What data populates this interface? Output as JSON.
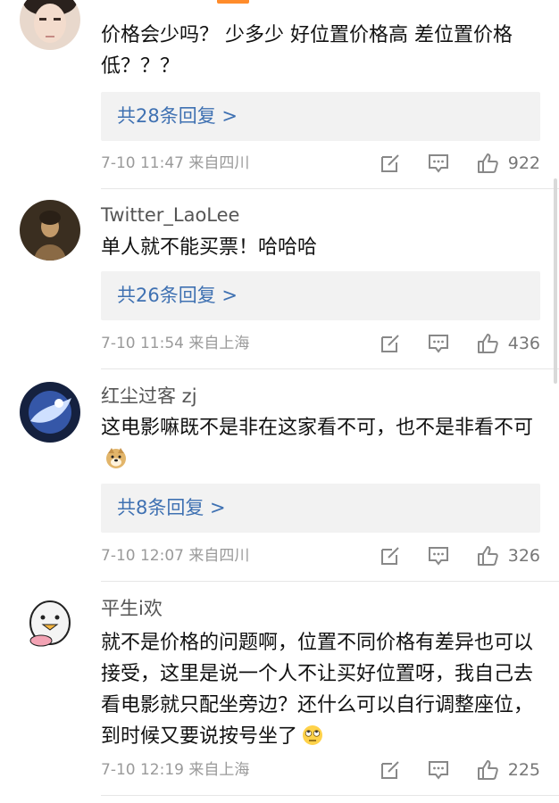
{
  "colors": {
    "link": "#3f71b2",
    "meta": "#9a9a9a",
    "reply_bg": "#f2f2f2"
  },
  "comments": [
    {
      "username": "",
      "text": "价格会少吗？ 少多少 好位置价格高 差位置价格低？？？",
      "replies_label": "共28条回复 >",
      "time": "7-10 11:47 来自四川",
      "likes": "922"
    },
    {
      "username": "Twitter_LaoLee",
      "text": "单人就不能买票！哈哈哈",
      "replies_label": "共26条回复 >",
      "time": "7-10 11:54 来自上海",
      "likes": "436"
    },
    {
      "username": "红尘过客 zj",
      "text": "这电影嘛既不是非在这家看不可，也不是非看不可",
      "emoji": "doge-emoji",
      "replies_label": "共8条回复 >",
      "time": "7-10 12:07 来自四川",
      "likes": "326"
    },
    {
      "username": "平生i欢",
      "text": "就不是价格的问题啊，位置不同价格有差异也可以接受，这里是说一个人不让买好位置呀，我自己去看电影就只配坐旁边？还什么可以自行调整座位，到时候又要说按号坐了",
      "emoji": "eye-roll-emoji",
      "time": "7-10 12:19 来自上海",
      "likes": "225"
    }
  ]
}
